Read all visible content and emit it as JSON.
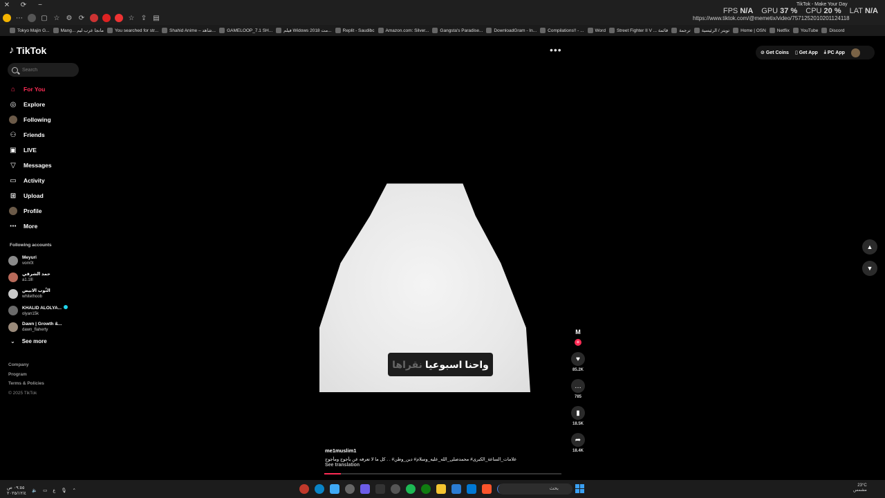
{
  "browser": {
    "tab_title": "TikTok - Make Your Day",
    "url": "https://www.tiktok.com/@memetix/video/7571252010201124118",
    "osd": {
      "fps_label": "FPS",
      "fps": "N/A",
      "gpu_label": "GPU",
      "gpu": "37 %",
      "cpu_label": "CPU",
      "cpu": "20 %",
      "lat_label": "LAT",
      "lat": "N/A"
    },
    "bookmarks": [
      "Tokyo Majin G...",
      "Mang... مانجا عرب ليم",
      "You searched for str...",
      "Shahid Anime – شاهد...",
      "GAMELOOP_7.1 SH...",
      "فيلم Widows 2018 مت...",
      "Replit - Saudibc",
      "Amazon.com: Silver...",
      "Gangsta's Paradise...",
      "DownloadGram - In...",
      "Compilations!! - ...",
      "Word",
      "Street Fighter II V ... قائمة",
      "ترجمة",
      "تويتر / الرئيسية",
      "Home | OSN",
      "Netflix",
      "YouTube",
      "Discord"
    ]
  },
  "sidebar": {
    "logo": "TikTok",
    "search_placeholder": "Search",
    "nav": [
      {
        "label": "For You",
        "icon": "home-icon"
      },
      {
        "label": "Explore",
        "icon": "compass-icon"
      },
      {
        "label": "Following",
        "icon": "following-avatar-icon"
      },
      {
        "label": "Friends",
        "icon": "friends-icon"
      },
      {
        "label": "LIVE",
        "icon": "live-icon"
      },
      {
        "label": "Messages",
        "icon": "messages-icon"
      },
      {
        "label": "Activity",
        "icon": "activity-icon"
      },
      {
        "label": "Upload",
        "icon": "upload-icon"
      },
      {
        "label": "Profile",
        "icon": "profile-avatar-icon"
      },
      {
        "label": "More",
        "icon": "more-icon"
      }
    ],
    "following_title": "Following accounts",
    "following": [
      {
        "name": "Meyuri",
        "handle": "vom0t",
        "color": "#8a8a8a"
      },
      {
        "name": "حمد الشرقي",
        "handle": "a1.1lll",
        "color": "#b86a5a"
      },
      {
        "name": "الثّوب الابيض",
        "handle": "whitethoob",
        "color": "#c9c9c9"
      },
      {
        "name": "KHALID ALOLYA...",
        "handle": "olyan15k",
        "color": "#6a6a6a",
        "verified": true
      },
      {
        "name": "Dawn | Growth &...",
        "handle": "dawn_flaherty",
        "color": "#9a8a7a"
      }
    ],
    "see_more": "See more",
    "footer": {
      "company": "Company",
      "program": "Program",
      "terms": "Terms & Policies",
      "copyright": "© 2025 TikTok"
    }
  },
  "top_actions": {
    "coins": "Get Coins",
    "app": "Get App",
    "pc": "PC App"
  },
  "video": {
    "subtitle_main": "واحنا اسبوعيا",
    "subtitle_dim": "نقراها",
    "author": "me1muslim1",
    "caption": "علامات_الساعة_الكبرى# محمدصلى_الله_عليه_وسلام# دين_وطن# . . كل ما لا تعرفه عن يأجوج ومأجوج",
    "see_translation": "See translation",
    "progress": 0.07
  },
  "rail": {
    "avatar_glyph": "M",
    "likes": "85.2K",
    "comments": "785",
    "saves": "18.5K",
    "shares": "18.4K",
    "music_glyph": "M"
  },
  "taskbar": {
    "search_text": "بحث",
    "temp": "23°C",
    "weather": "مشمس",
    "time": "٠٩:٥٥ ص",
    "date": "٢٠٢٥/١٢/٤"
  }
}
